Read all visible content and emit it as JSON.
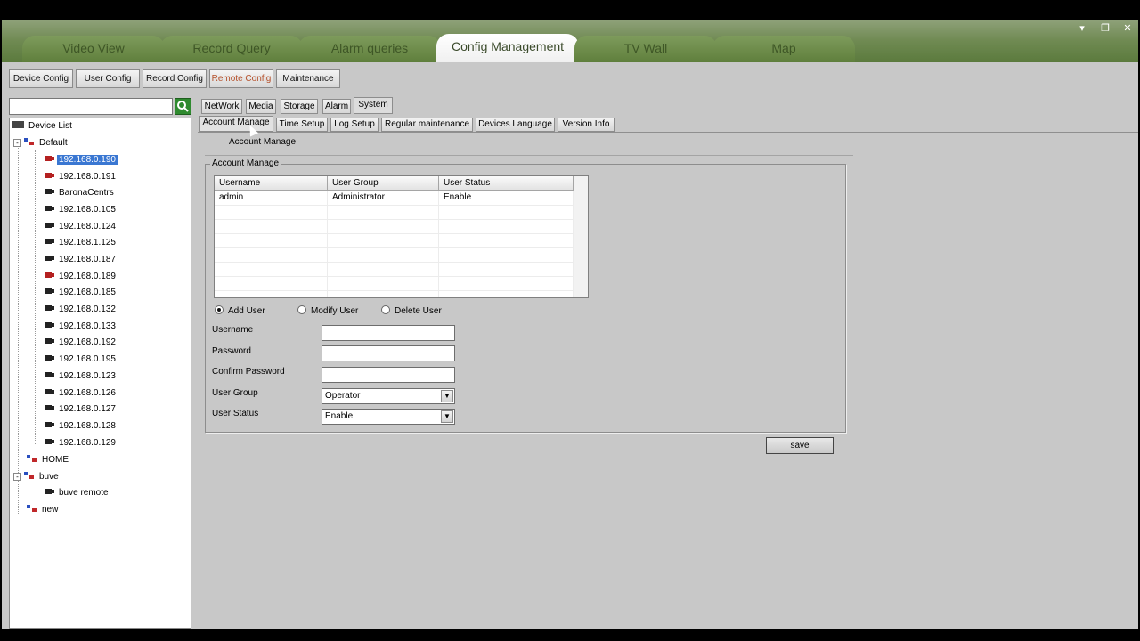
{
  "window_controls": {
    "menu": "▾",
    "restore": "❐",
    "close": "✕"
  },
  "main_tabs": [
    {
      "label": "Video View"
    },
    {
      "label": "Record Query"
    },
    {
      "label": "Alarm queries"
    },
    {
      "label": "Config Management"
    },
    {
      "label": "TV Wall"
    },
    {
      "label": "Map"
    }
  ],
  "sub_toolbar": [
    {
      "label": "Device Config"
    },
    {
      "label": "User Config"
    },
    {
      "label": "Record Config"
    },
    {
      "label": "Remote Config"
    },
    {
      "label": "Maintenance"
    }
  ],
  "search": {
    "value": ""
  },
  "tree": {
    "root": "Device List",
    "groups": [
      {
        "name": "Default",
        "devices": [
          "192.168.0.190",
          "192.168.0.191",
          "BaronaCentrs",
          "192.168.0.105",
          "192.168.0.124",
          "192.168.1.125",
          "192.168.0.187",
          "192.168.0.189",
          "192.168.0.185",
          "192.168.0.132",
          "192.168.0.133",
          "192.168.0.192",
          "192.168.0.195",
          "192.168.0.123",
          "192.168.0.126",
          "192.168.0.127",
          "192.168.0.128",
          "192.168.0.129"
        ]
      },
      {
        "name": "HOME"
      },
      {
        "name": "buve",
        "devices": [
          "buve remote"
        ]
      },
      {
        "name": "new"
      }
    ]
  },
  "section_tabs": [
    {
      "label": "NetWork"
    },
    {
      "label": "Media"
    },
    {
      "label": "Storage"
    },
    {
      "label": "Alarm"
    },
    {
      "label": "System"
    }
  ],
  "system_tabs": [
    {
      "label": "Account Manage"
    },
    {
      "label": "Time Setup"
    },
    {
      "label": "Log Setup"
    },
    {
      "label": "Regular maintenance"
    },
    {
      "label": "Devices Language"
    },
    {
      "label": "Version Info"
    }
  ],
  "section_title": "Account Manage",
  "group_title": "Account Manage",
  "grid": {
    "headers": [
      "Username",
      "User Group",
      "User Status"
    ],
    "rows": [
      [
        "admin",
        "Administrator",
        "Enable"
      ]
    ]
  },
  "actions": {
    "add": "Add User",
    "modify": "Modify User",
    "delete": "Delete User"
  },
  "form": {
    "username_label": "Username",
    "password_label": "Password",
    "confirm_label": "Confirm Password",
    "group_label": "User Group",
    "group_value": "Operator",
    "status_label": "User Status",
    "status_value": "Enable"
  },
  "save_label": "save"
}
